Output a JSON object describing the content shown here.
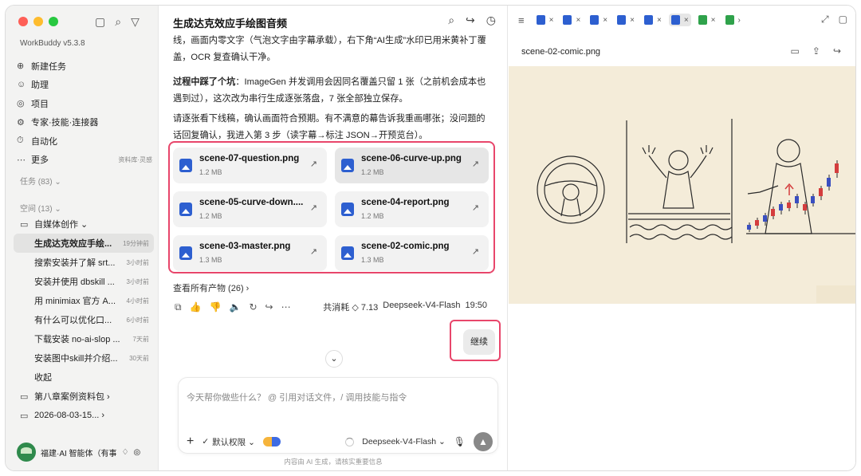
{
  "sidebar": {
    "version": "WorkBuddy v5.3.8",
    "nav": [
      {
        "icon": "⊕",
        "icon_name": "plus-circle-icon",
        "label": "新建任务",
        "right": ""
      },
      {
        "icon": "☺",
        "icon_name": "assistant-icon",
        "label": "助理",
        "right": ""
      },
      {
        "icon": "◎",
        "icon_name": "project-icon",
        "label": "项目",
        "right": ""
      },
      {
        "icon": "⚙",
        "icon_name": "expert-icon",
        "label": "专家·技能·连接器",
        "right": ""
      },
      {
        "icon": "⏱",
        "icon_name": "automation-icon",
        "label": "自动化",
        "right": ""
      },
      {
        "icon": "⋯",
        "icon_name": "more-icon",
        "label": "更多",
        "right": "资料库·灵感"
      }
    ],
    "tasks_label": "任务 (83) ⌄",
    "spaces_label": "空间 (13) ⌄",
    "spaces": [
      {
        "label": "自媒体创作 ⌄",
        "time": "",
        "kind": "folder"
      },
      {
        "label": "生成达克效应手绘...",
        "time": "19分钟前",
        "kind": "sub",
        "selected": true
      },
      {
        "label": "搜索安装并了解 srt...",
        "time": "3小时前",
        "kind": "sub"
      },
      {
        "label": "安装并使用 dbskill ...",
        "time": "3小时前",
        "kind": "sub"
      },
      {
        "label": "用 minimiax 官方 A...",
        "time": "4小时前",
        "kind": "sub"
      },
      {
        "label": "有什么可以优化口...",
        "time": "6小时前",
        "kind": "sub"
      },
      {
        "label": "下载安装 no-ai-slop ...",
        "time": "7天前",
        "kind": "sub"
      },
      {
        "label": "安装图中skill并介绍...",
        "time": "30天前",
        "kind": "sub"
      },
      {
        "label": "收起",
        "time": "",
        "kind": "sub-plain"
      },
      {
        "label": "第八章案例资料包  ›",
        "time": "",
        "kind": "folder"
      },
      {
        "label": "2026-08-03-15...  ›",
        "time": "",
        "kind": "folder"
      }
    ],
    "user_name": "福建·AI 智能体（有事",
    "user_icons": [
      "🔔",
      "⚙"
    ]
  },
  "chat": {
    "title": "生成达克效应手绘图音频",
    "top_text": "线，画面内零文字（气泡文字由字幕承载），右下角“AI生成”水印已用米黄补丁覆盖，OCR 复查确认干净。",
    "note_bold": "过程中踩了个坑",
    "note_rest": "：ImageGen 并发调用会因同名覆盖只留 1 张（之前机会成本也遇到过），这次改为串行生成逐张落盘，7 张全部独立保存。",
    "confirm_text": "请逐张看下线稿，确认画面符合预期。有不满意的幕告诉我重画哪张；没问题的话回复确认，我进入第 3 步（读字幕→标注 JSON→开预览台）。",
    "files": [
      {
        "name": "scene-07-question.png",
        "size": "1.2 MB"
      },
      {
        "name": "scene-06-curve-up.png",
        "size": "1.2 MB"
      },
      {
        "name": "scene-05-curve-down....",
        "size": "1.2 MB"
      },
      {
        "name": "scene-04-report.png",
        "size": "1.2 MB"
      },
      {
        "name": "scene-03-master.png",
        "size": "1.3 MB"
      },
      {
        "name": "scene-02-comic.png",
        "size": "1.3 MB"
      }
    ],
    "view_all": "查看所有产物 (26) ›",
    "usage": "共消耗 ◇ 7.13",
    "model_tag": "Deepseek-V4-Flash",
    "time": "19:50",
    "continue": "继续",
    "input_placeholder": "今天帮你做些什么？ @ 引用对话文件，/ 调用技能与指令",
    "permission": "默认权限 ⌄",
    "model_select": "Deepseek-V4-Flash ⌄",
    "disclaimer": "内容由 AI 生成，请核实重要信息"
  },
  "viewer": {
    "filename": "scene-02-comic.png",
    "tab_count": 7
  },
  "colors": {
    "highlight": "#e8466b",
    "file_icon": "#2d5fd0",
    "preview_bg": "#f4ecd9"
  }
}
